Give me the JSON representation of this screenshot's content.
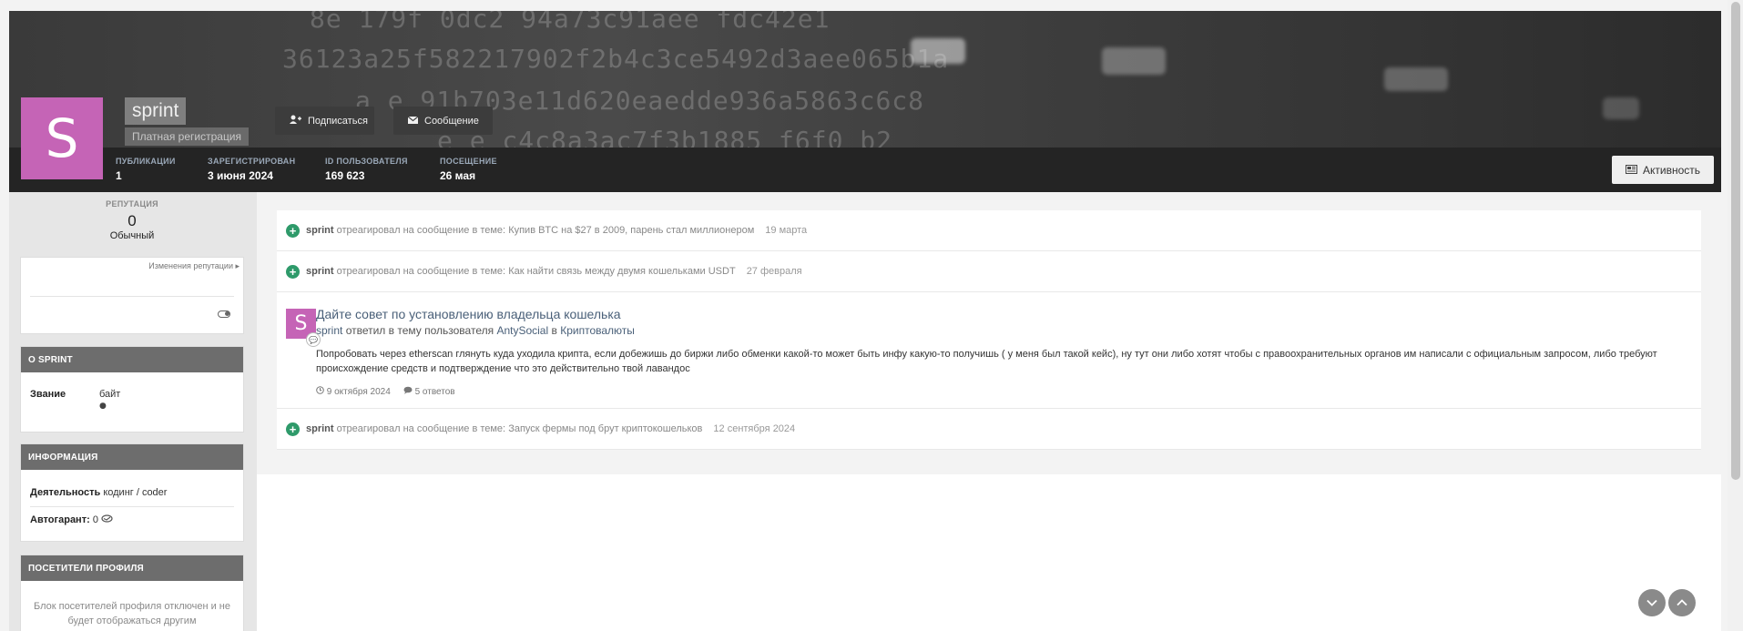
{
  "profile": {
    "avatar_letter": "S",
    "username": "sprint",
    "group": "Платная регистрация",
    "buttons": {
      "follow": "Подписаться",
      "message": "Сообщение",
      "activity": "Активность"
    },
    "stats": [
      {
        "label": "Публикации",
        "value": "1"
      },
      {
        "label": "Зарегистрирован",
        "value": "3 июня 2024"
      },
      {
        "label": "ID пользователя",
        "value": "169 623"
      },
      {
        "label": "Посещение",
        "value": "26 мая"
      }
    ]
  },
  "cover": {
    "lines": [
      "8e  179f  0dc2  94a73c91aee  fdc42e1",
      "36123a25f582217902f2b4c3ce5492d3aee065b1a",
      "a  e  91b703e11d620eaedde936a5863c6c8",
      "e  e  c4c8a3ac7f3b1885  f6f0  b2"
    ]
  },
  "sidebar": {
    "reputation": {
      "label": "РЕПУТАЦИЯ",
      "value": "0",
      "level": "Обычный",
      "changes_link": "Изменения репутации ▸"
    },
    "about": {
      "title": "О SPRINT",
      "rank_label": "Звание",
      "rank_value": "байт",
      "rank_dot": "●"
    },
    "info": {
      "title": "ИНФОРМАЦИЯ",
      "activity_label": "Деятельность",
      "activity_value": "кодинг / coder",
      "guarantor_label": "Автогарант:",
      "guarantor_value": "0"
    },
    "visitors": {
      "title": "ПОСЕТИТЕЛИ ПРОФИЛЯ",
      "text": "Блок посетителей профиля отключен и не будет отображаться другим пользователям"
    }
  },
  "feed": [
    {
      "type": "reaction",
      "user": "sprint",
      "action": "отреагировал на сообщение в теме:",
      "topic": "Купив BTC на $27 в 2009, парень стал миллионером",
      "date": "19 марта"
    },
    {
      "type": "reaction",
      "user": "sprint",
      "action": "отреагировал на сообщение в теме:",
      "topic": "Как найти связь между двумя кошельками USDT",
      "date": "27 февраля"
    },
    {
      "type": "post",
      "avatar_letter": "S",
      "title": "Дайте совет по установлению владельца кошелька",
      "user": "sprint",
      "action": "ответил в тему пользователя",
      "author": "AntySocial",
      "in_word": "в",
      "forum": "Криптовалюты",
      "text": "Попробовать через etherscan глянуть куда уходила крипта, если добежишь до биржи либо обменки какой-то может быть инфу какую-то получишь ( у меня был такой кейс), ну тут они либо хотят чтобы с правоохранительных органов им написали с официальным запросом, либо требуют происхождение средств и подтверждение что это действительно твой лавандос",
      "date": "9 октября 2024",
      "replies": "5 ответов"
    },
    {
      "type": "reaction",
      "user": "sprint",
      "action": "отреагировал на сообщение в теме:",
      "topic": "Запуск фермы под брут криптокошельков",
      "date": "12 сентября 2024"
    }
  ],
  "colors": {
    "avatar": "#c564b6",
    "reaction_icon": "#2e9a6a",
    "card_header": "#6d6d6d",
    "link": "#4a6079"
  }
}
